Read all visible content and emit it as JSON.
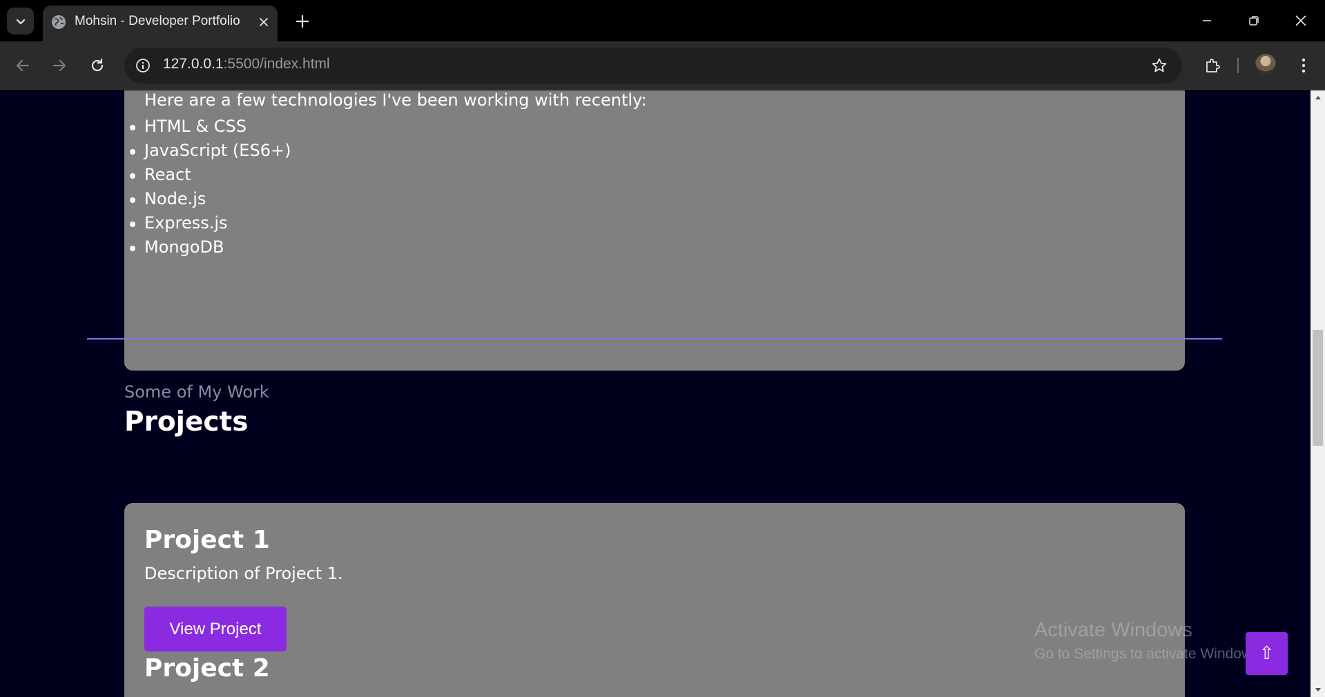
{
  "browser": {
    "tab_title": "Mohsin - Developer Portfolio",
    "url_host": "127.0.0.1",
    "url_rest": ":5500/index.html"
  },
  "about": {
    "intro": "Here are a few technologies I've been working with recently:",
    "skills": [
      "HTML & CSS",
      "JavaScript (ES6+)",
      "React",
      "Node.js",
      "Express.js",
      "MongoDB"
    ]
  },
  "projects": {
    "subheading": "Some of My Work",
    "title": "Projects",
    "items": [
      {
        "title": "Project 1",
        "description": "Description of Project 1.",
        "button": "View Project"
      },
      {
        "title": "Project 2"
      }
    ]
  },
  "watermark": {
    "title": "Activate Windows",
    "subtitle": "Go to Settings to activate Windows."
  },
  "scroll_top_label": "⇧",
  "colors": {
    "page_bg": "#00001e",
    "card_bg": "#808080",
    "accent": "#8a2be2",
    "divider": "#7a78e8"
  }
}
